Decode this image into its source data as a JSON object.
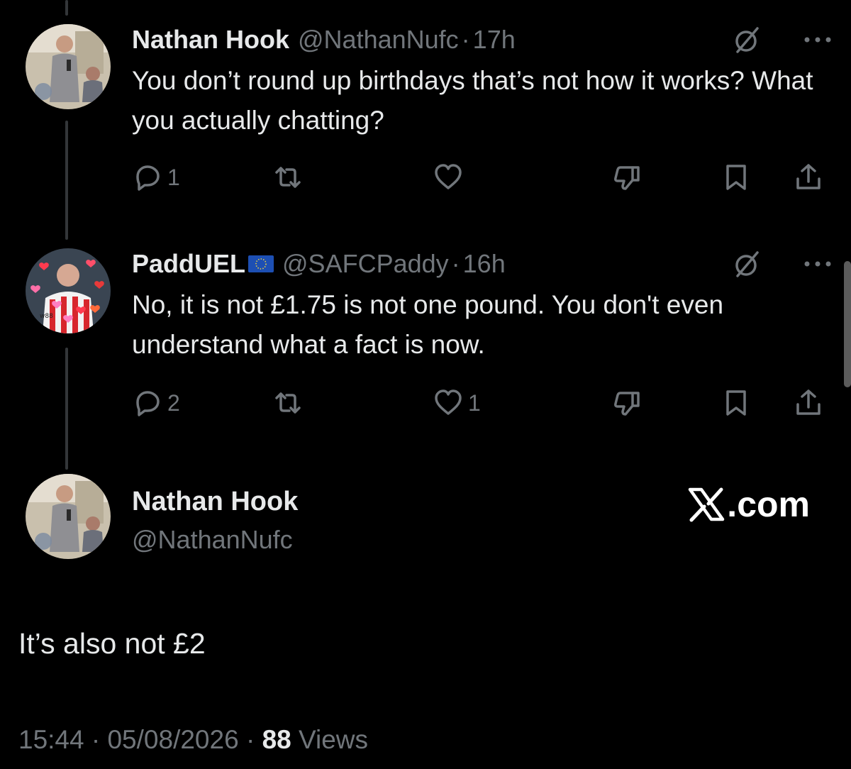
{
  "replies": [
    {
      "display_name": "Nathan Hook",
      "handle": "@NathanNufc",
      "separator": "·",
      "time": "17h",
      "text": "You don’t round up birthdays that’s not how it works? What you actually chatting?",
      "reply_count": "1",
      "retweet_count": "",
      "like_count": "",
      "avatar_icon": "avatar-photo"
    },
    {
      "display_name": "PaddUEL",
      "handle": "@SAFCPaddy",
      "separator": "·",
      "time": "16h",
      "text": "No, it is not £1.75 is not one pound. You don't even understand what a fact is now.",
      "reply_count": "2",
      "retweet_count": "",
      "like_count": "1",
      "avatar_icon": "avatar-photo",
      "flag_icon": "eu-flag-icon"
    }
  ],
  "main_tweet": {
    "display_name": "Nathan Hook",
    "handle": "@NathanNufc",
    "text": "It’s also not £2",
    "time": "15:44",
    "separator": "·",
    "date": "05/08/2026",
    "views_count": "88",
    "views_label": "Views"
  },
  "watermark": {
    "suffix": ".com"
  },
  "colors": {
    "background": "#000000",
    "primary_text": "#e7e9ea",
    "secondary_text": "#71767b",
    "thread_line": "#333639"
  }
}
